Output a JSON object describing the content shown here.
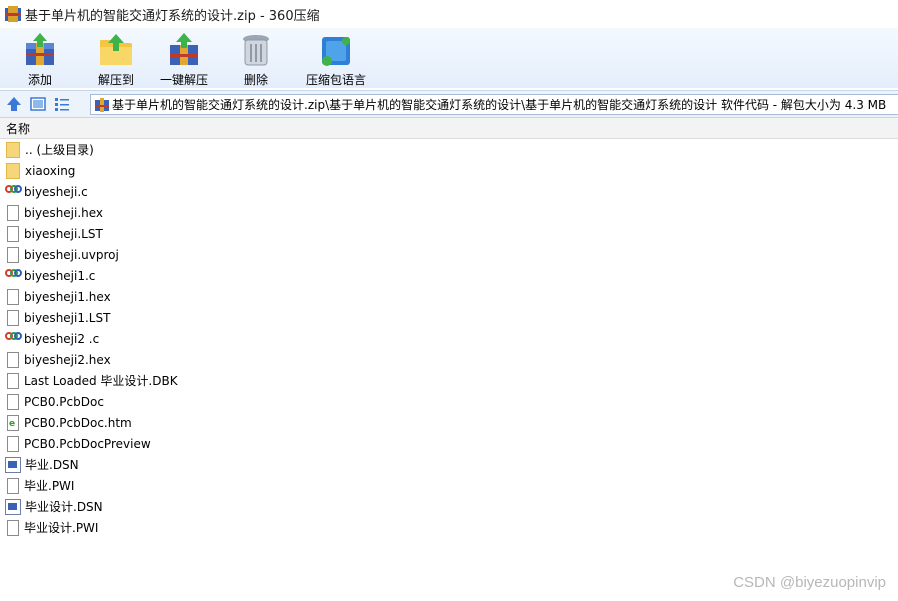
{
  "window": {
    "title": "基于单片机的智能交通灯系统的设计.zip - 360压缩"
  },
  "toolbar": {
    "items": [
      {
        "label": "添加",
        "icon": "add-archive-icon"
      },
      {
        "label": "解压到",
        "icon": "extract-to-icon"
      },
      {
        "label": "一键解压",
        "icon": "one-click-extract-icon"
      },
      {
        "label": "删除",
        "icon": "trash-icon"
      },
      {
        "label": "压缩包语言",
        "icon": "archive-language-icon"
      }
    ]
  },
  "nav": {
    "path": "基于单片机的智能交通灯系统的设计.zip\\基于单片机的智能交通灯系统的设计\\基于单片机的智能交通灯系统的设计 软件代码 - 解包大小为 4.3 MB"
  },
  "list": {
    "column_name": "名称",
    "files": [
      {
        "name": ".. (上级目录)",
        "type": "folder"
      },
      {
        "name": "xiaoxing",
        "type": "folder"
      },
      {
        "name": "biyesheji.c",
        "type": "c"
      },
      {
        "name": "biyesheji.hex",
        "type": "doc"
      },
      {
        "name": "biyesheji.LST",
        "type": "doc"
      },
      {
        "name": "biyesheji.uvproj",
        "type": "doc"
      },
      {
        "name": "biyesheji1.c",
        "type": "c"
      },
      {
        "name": "biyesheji1.hex",
        "type": "doc"
      },
      {
        "name": "biyesheji1.LST",
        "type": "doc"
      },
      {
        "name": "biyesheji2 .c",
        "type": "c"
      },
      {
        "name": "biyesheji2.hex",
        "type": "doc"
      },
      {
        "name": "Last Loaded 毕业设计.DBK",
        "type": "doc"
      },
      {
        "name": "PCB0.PcbDoc",
        "type": "doc"
      },
      {
        "name": "PCB0.PcbDoc.htm",
        "type": "htm"
      },
      {
        "name": "PCB0.PcbDocPreview",
        "type": "doc"
      },
      {
        "name": "毕业.DSN",
        "type": "dsn"
      },
      {
        "name": "毕业.PWI",
        "type": "doc"
      },
      {
        "name": "毕业设计.DSN",
        "type": "dsn"
      },
      {
        "name": "毕业设计.PWI",
        "type": "doc"
      }
    ]
  },
  "watermark": "CSDN @biyezuopinvip"
}
